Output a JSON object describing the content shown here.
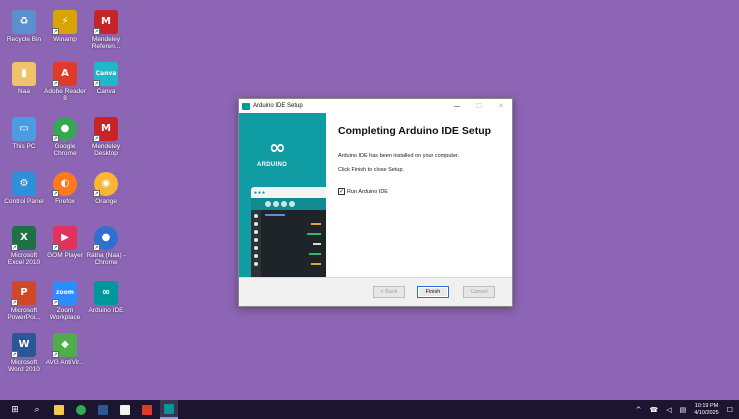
{
  "desktop": {
    "icons": [
      {
        "label": "Recycle Bin",
        "icon": "recycle-bin-icon",
        "color": "#5b8fcf"
      },
      {
        "label": "Winamp",
        "icon": "winamp-icon",
        "color": "#d9a300"
      },
      {
        "label": "Mendeley Referen...",
        "icon": "mendeley-icon",
        "color": "#c7242a"
      },
      {
        "label": "Naa",
        "icon": "user-folder-icon",
        "color": "#f0c26a"
      },
      {
        "label": "Adobe Reader 8",
        "icon": "adobe-reader-icon",
        "color": "#e13a2a"
      },
      {
        "label": "Canva",
        "icon": "canva-icon",
        "color": "#1fb7c9"
      },
      {
        "label": "This PC",
        "icon": "computer-icon",
        "color": "#4d9be0"
      },
      {
        "label": "Google Chrome",
        "icon": "chrome-icon",
        "color": "#34a853"
      },
      {
        "label": "Mendeley Desktop",
        "icon": "mendeley-icon",
        "color": "#c7242a"
      },
      {
        "label": "Control Panel",
        "icon": "control-panel-icon",
        "color": "#2f8fd8"
      },
      {
        "label": "Firefox",
        "icon": "firefox-icon",
        "color": "#ff7a1a"
      },
      {
        "label": "Orange",
        "icon": "orange-icon",
        "color": "#f7b733"
      },
      {
        "label": "Microsoft Excel 2010",
        "icon": "excel-icon",
        "color": "#1e7145"
      },
      {
        "label": "GOM Player",
        "icon": "gom-player-icon",
        "color": "#e0325a"
      },
      {
        "label": "Ratna (Naa) - Chrome",
        "icon": "chrome-profile-icon",
        "color": "#2f6fd1"
      },
      {
        "label": "Microsoft PowerPoi...",
        "icon": "powerpoint-icon",
        "color": "#d24726"
      },
      {
        "label": "Zoom Workplace",
        "icon": "zoom-icon",
        "color": "#2d8cff"
      },
      {
        "label": "Arduino IDE",
        "icon": "arduino-icon",
        "color": "#00979c"
      },
      {
        "label": "Microsoft Word 2010",
        "icon": "word-icon",
        "color": "#2b5797"
      },
      {
        "label": "AVG AntiVir...",
        "icon": "avg-icon",
        "color": "#4fae4a"
      }
    ]
  },
  "window": {
    "title": "Arduino IDE Setup",
    "minimize": "—",
    "maximize": "☐",
    "close": "✕",
    "banner_logo": "∞",
    "banner_text": "ARDUINO",
    "heading": "Completing Arduino IDE Setup",
    "line1": "Arduino IDE has been installed on your computer.",
    "line2": "Click Finish to close Setup.",
    "checkbox_label": "Run Arduino IDE",
    "checkbox_mark": "✓",
    "back_label": "< Back",
    "finish_label": "Finish",
    "cancel_label": "Cancel"
  },
  "taskbar": {
    "start": "⊞",
    "search": "⌕",
    "items": [
      {
        "icon": "file-explorer-icon",
        "color": "#f2c94c"
      },
      {
        "icon": "chrome-icon",
        "color": "#34a853"
      },
      {
        "icon": "word-icon",
        "color": "#2b5797"
      },
      {
        "icon": "store-icon",
        "color": "#f2f2f2"
      },
      {
        "icon": "adobe-reader-icon",
        "color": "#e13a2a"
      },
      {
        "icon": "arduino-icon",
        "color": "#00979c"
      }
    ],
    "tray": {
      "chevron": "^",
      "network": "☎",
      "volume": "◁",
      "battery": "▤",
      "time": "10:19 PM",
      "date": "4/10/2025",
      "notifications": "☐"
    }
  }
}
